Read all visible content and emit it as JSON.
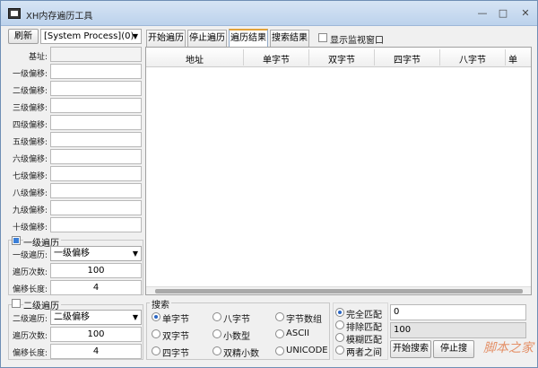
{
  "window": {
    "title": "XH内存遍历工具",
    "minimize": "—",
    "maximize": "□",
    "close": "✕"
  },
  "toolbar": {
    "refresh_label": "刷新",
    "process_value": "[System Process](0)"
  },
  "base": {
    "label": "基址:",
    "value": ""
  },
  "offsets": [
    {
      "label": "一级偏移:",
      "value": ""
    },
    {
      "label": "二级偏移:",
      "value": ""
    },
    {
      "label": "三级偏移:",
      "value": ""
    },
    {
      "label": "四级偏移:",
      "value": ""
    },
    {
      "label": "五级偏移:",
      "value": ""
    },
    {
      "label": "六级偏移:",
      "value": ""
    },
    {
      "label": "七级偏移:",
      "value": ""
    },
    {
      "label": "八级偏移:",
      "value": ""
    },
    {
      "label": "九级偏移:",
      "value": ""
    },
    {
      "label": "十级偏移:",
      "value": ""
    }
  ],
  "traverse1": {
    "checkbox_label": "一级遍历",
    "checked": true,
    "level_label": "一级遍历:",
    "level_value": "一级偏移",
    "count_label": "遍历次数:",
    "count_value": "100",
    "step_label": "偏移长度:",
    "step_value": "4"
  },
  "traverse2": {
    "checkbox_label": "二级遍历",
    "checked": false,
    "level_label": "二级遍历:",
    "level_value": "二级偏移",
    "count_label": "遍历次数:",
    "count_value": "100",
    "step_label": "偏移长度:",
    "step_value": "4"
  },
  "tabs": {
    "start": "开始遍历",
    "stop": "停止遍历",
    "result": "遍历结果",
    "search": "搜索结果",
    "monitor_label": "显示监视窗口"
  },
  "grid": {
    "columns": [
      "地址",
      "单字节",
      "双字节",
      "四字节",
      "八字节",
      "单"
    ]
  },
  "search": {
    "group_label": "搜索",
    "types": [
      {
        "label": "单字节",
        "selected": true
      },
      {
        "label": "八字节",
        "selected": false
      },
      {
        "label": "字节数组",
        "selected": false
      },
      {
        "label": "双字节",
        "selected": false
      },
      {
        "label": "小数型",
        "selected": false
      },
      {
        "label": "ASCII",
        "selected": false
      },
      {
        "label": "四字节",
        "selected": false
      },
      {
        "label": "双精小数",
        "selected": false
      },
      {
        "label": "UNICODE",
        "selected": false
      }
    ],
    "modes": [
      {
        "label": "完全匹配",
        "selected": true
      },
      {
        "label": "排除匹配",
        "selected": false
      },
      {
        "label": "模糊匹配",
        "selected": false
      },
      {
        "label": "两者之间",
        "selected": false
      }
    ],
    "value1": "0",
    "value2": "100",
    "start_label": "开始搜索",
    "stop_label": "停止搜"
  },
  "watermark": "脚本之家"
}
